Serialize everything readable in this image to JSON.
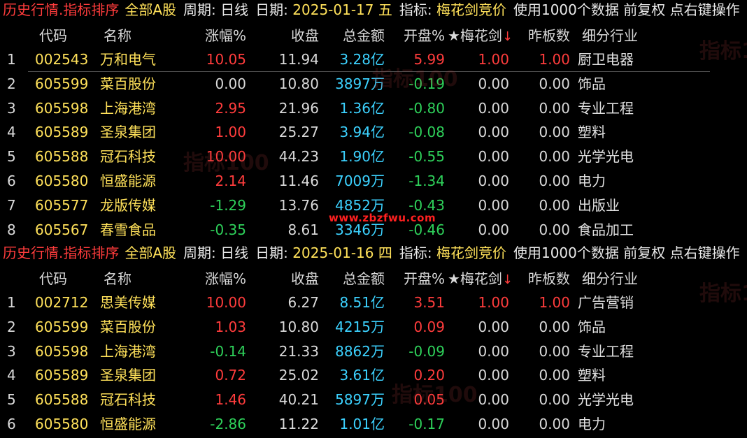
{
  "panels": [
    {
      "title": {
        "section": "历史行情.指标排序",
        "market": "全部A股",
        "period_label": "周期:",
        "period_value": "日线",
        "date_label": "日期:",
        "date_value": "2025-01-17 五",
        "indicator_label": "指标:",
        "indicator_value": "梅花剑竞价",
        "note": "使用1000个数据 前复权 点右键操作"
      },
      "headers": {
        "code": "代码",
        "name": "名称",
        "change": "涨幅%",
        "close": "收盘",
        "amount": "总金额",
        "open": "开盘%",
        "mhj": "★梅花剑",
        "sort_arrow": "↓",
        "zb": "昨板数",
        "industry": "细分行业"
      },
      "rows": [
        {
          "idx": "1",
          "code": "002543",
          "name": "万和电气",
          "change": "10.05",
          "close": "11.94",
          "amount": "3.28亿",
          "open": "5.99",
          "mhj": "1.00",
          "zb": "1.00",
          "industry": "厨卫电器"
        },
        {
          "idx": "2",
          "code": "605599",
          "name": "菜百股份",
          "change": "0.00",
          "close": "10.80",
          "amount": "3897万",
          "open": "-0.19",
          "mhj": "0.00",
          "zb": "0.00",
          "industry": "饰品"
        },
        {
          "idx": "3",
          "code": "605598",
          "name": "上海港湾",
          "change": "2.95",
          "close": "21.96",
          "amount": "1.36亿",
          "open": "-0.80",
          "mhj": "0.00",
          "zb": "0.00",
          "industry": "专业工程"
        },
        {
          "idx": "4",
          "code": "605589",
          "name": "圣泉集团",
          "change": "1.00",
          "close": "25.27",
          "amount": "3.94亿",
          "open": "-0.08",
          "mhj": "0.00",
          "zb": "0.00",
          "industry": "塑料"
        },
        {
          "idx": "5",
          "code": "605588",
          "name": "冠石科技",
          "change": "10.00",
          "close": "44.23",
          "amount": "1.90亿",
          "open": "-0.55",
          "mhj": "0.00",
          "zb": "0.00",
          "industry": "光学光电"
        },
        {
          "idx": "6",
          "code": "605580",
          "name": "恒盛能源",
          "change": "2.14",
          "close": "11.46",
          "amount": "7009万",
          "open": "-1.34",
          "mhj": "0.00",
          "zb": "0.00",
          "industry": "电力"
        },
        {
          "idx": "7",
          "code": "605577",
          "name": "龙版传媒",
          "change": "-1.29",
          "close": "13.76",
          "amount": "4852万",
          "open": "-0.43",
          "mhj": "0.00",
          "zb": "0.00",
          "industry": "出版业"
        },
        {
          "idx": "8",
          "code": "605567",
          "name": "春雪食品",
          "change": "-0.35",
          "close": "8.61",
          "amount": "3346万",
          "open": "-0.46",
          "mhj": "0.00",
          "zb": "0.00",
          "industry": "食品加工"
        }
      ]
    },
    {
      "title": {
        "section": "历史行情.指标排序",
        "market": "全部A股",
        "period_label": "周期:",
        "period_value": "日线",
        "date_label": "日期:",
        "date_value": "2025-01-16 四",
        "indicator_label": "指标:",
        "indicator_value": "梅花剑竞价",
        "note": "使用1000个数据 前复权 点右键操作"
      },
      "headers": {
        "code": "代码",
        "name": "名称",
        "change": "涨幅%",
        "close": "收盘",
        "amount": "总金额",
        "open": "开盘%",
        "mhj": "★梅花剑",
        "sort_arrow": "↓",
        "zb": "昨板数",
        "industry": "细分行业"
      },
      "rows": [
        {
          "idx": "1",
          "code": "002712",
          "name": "思美传媒",
          "change": "10.00",
          "close": "6.27",
          "amount": "8.51亿",
          "open": "3.51",
          "mhj": "1.00",
          "zb": "1.00",
          "industry": "广告营销"
        },
        {
          "idx": "2",
          "code": "605599",
          "name": "菜百股份",
          "change": "1.03",
          "close": "10.80",
          "amount": "4215万",
          "open": "0.09",
          "mhj": "0.00",
          "zb": "0.00",
          "industry": "饰品"
        },
        {
          "idx": "3",
          "code": "605598",
          "name": "上海港湾",
          "change": "-0.14",
          "close": "21.33",
          "amount": "8862万",
          "open": "-0.09",
          "mhj": "0.00",
          "zb": "0.00",
          "industry": "专业工程"
        },
        {
          "idx": "4",
          "code": "605589",
          "name": "圣泉集团",
          "change": "0.72",
          "close": "25.02",
          "amount": "3.61亿",
          "open": "0.20",
          "mhj": "0.00",
          "zb": "0.00",
          "industry": "塑料"
        },
        {
          "idx": "5",
          "code": "605588",
          "name": "冠石科技",
          "change": "1.46",
          "close": "40.21",
          "amount": "5897万",
          "open": "0.05",
          "mhj": "0.00",
          "zb": "0.00",
          "industry": "光学光电"
        },
        {
          "idx": "6",
          "code": "605580",
          "name": "恒盛能源",
          "change": "-2.86",
          "close": "11.22",
          "amount": "1.01亿",
          "open": "-0.17",
          "mhj": "0.00",
          "zb": "0.00",
          "industry": "电力"
        }
      ]
    }
  ],
  "watermark": {
    "site": "www.zbzfwu.com",
    "brand": "指标100"
  },
  "colors": {
    "up": "#ff3c3c",
    "down": "#2ed15a",
    "flat": "#d9d9d9",
    "code": "#ffe15a",
    "amount": "#3cd2ff",
    "background": "#000000"
  }
}
